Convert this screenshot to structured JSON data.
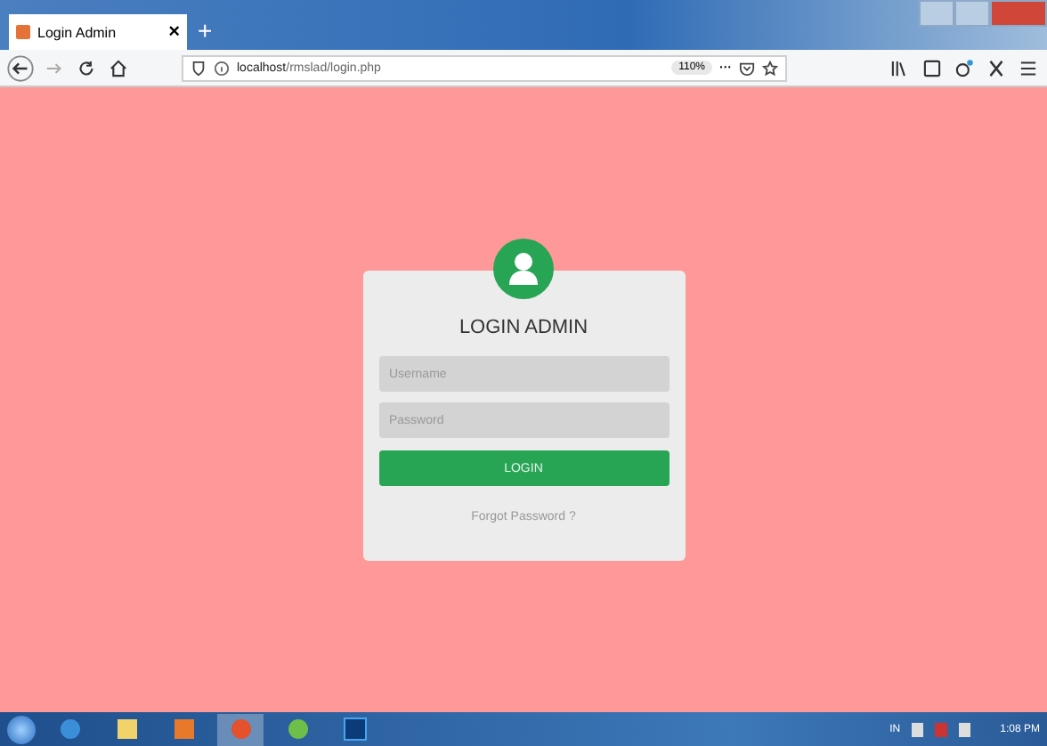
{
  "browser": {
    "tab": {
      "title": "Login Admin",
      "close": "×"
    },
    "new_tab": "+",
    "url": {
      "host": "localhost",
      "path": "/rmslad/login.php"
    },
    "zoom": "110%",
    "more": "···"
  },
  "login": {
    "title": "LOGIN ADMIN",
    "username": {
      "placeholder": "Username"
    },
    "password": {
      "placeholder": "Password"
    },
    "button": "LOGIN",
    "forgot": "Forgot Password ?"
  },
  "taskbar": {
    "language": "IN",
    "time": "1:08 PM"
  }
}
